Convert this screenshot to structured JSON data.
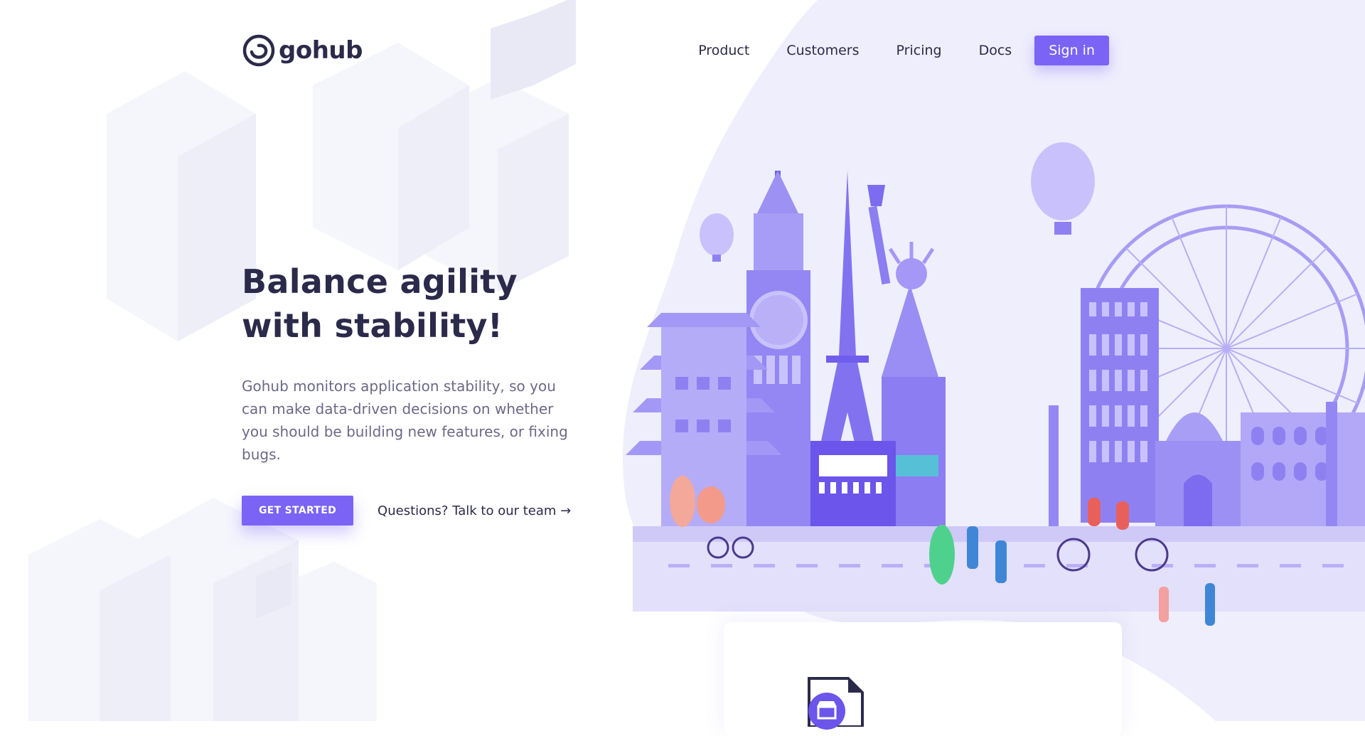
{
  "brand": {
    "name": "gohub",
    "accent": "#7b63f5",
    "text": "#2c2a4a"
  },
  "nav": {
    "items": [
      {
        "label": "Product"
      },
      {
        "label": "Customers"
      },
      {
        "label": "Pricing"
      },
      {
        "label": "Docs"
      }
    ],
    "signin_label": "Sign in"
  },
  "hero": {
    "title": "Balance agility with stability!",
    "description": "Gohub monitors application stability, so you can make data-driven decisions on whether you should be building new features, or fixing bugs.",
    "cta_label": "GET STARTED",
    "talk_label": "Questions? Talk to our team →"
  },
  "illustration": {
    "icons": [
      "landmarks-illustration",
      "store-icon",
      "document-icon"
    ]
  }
}
